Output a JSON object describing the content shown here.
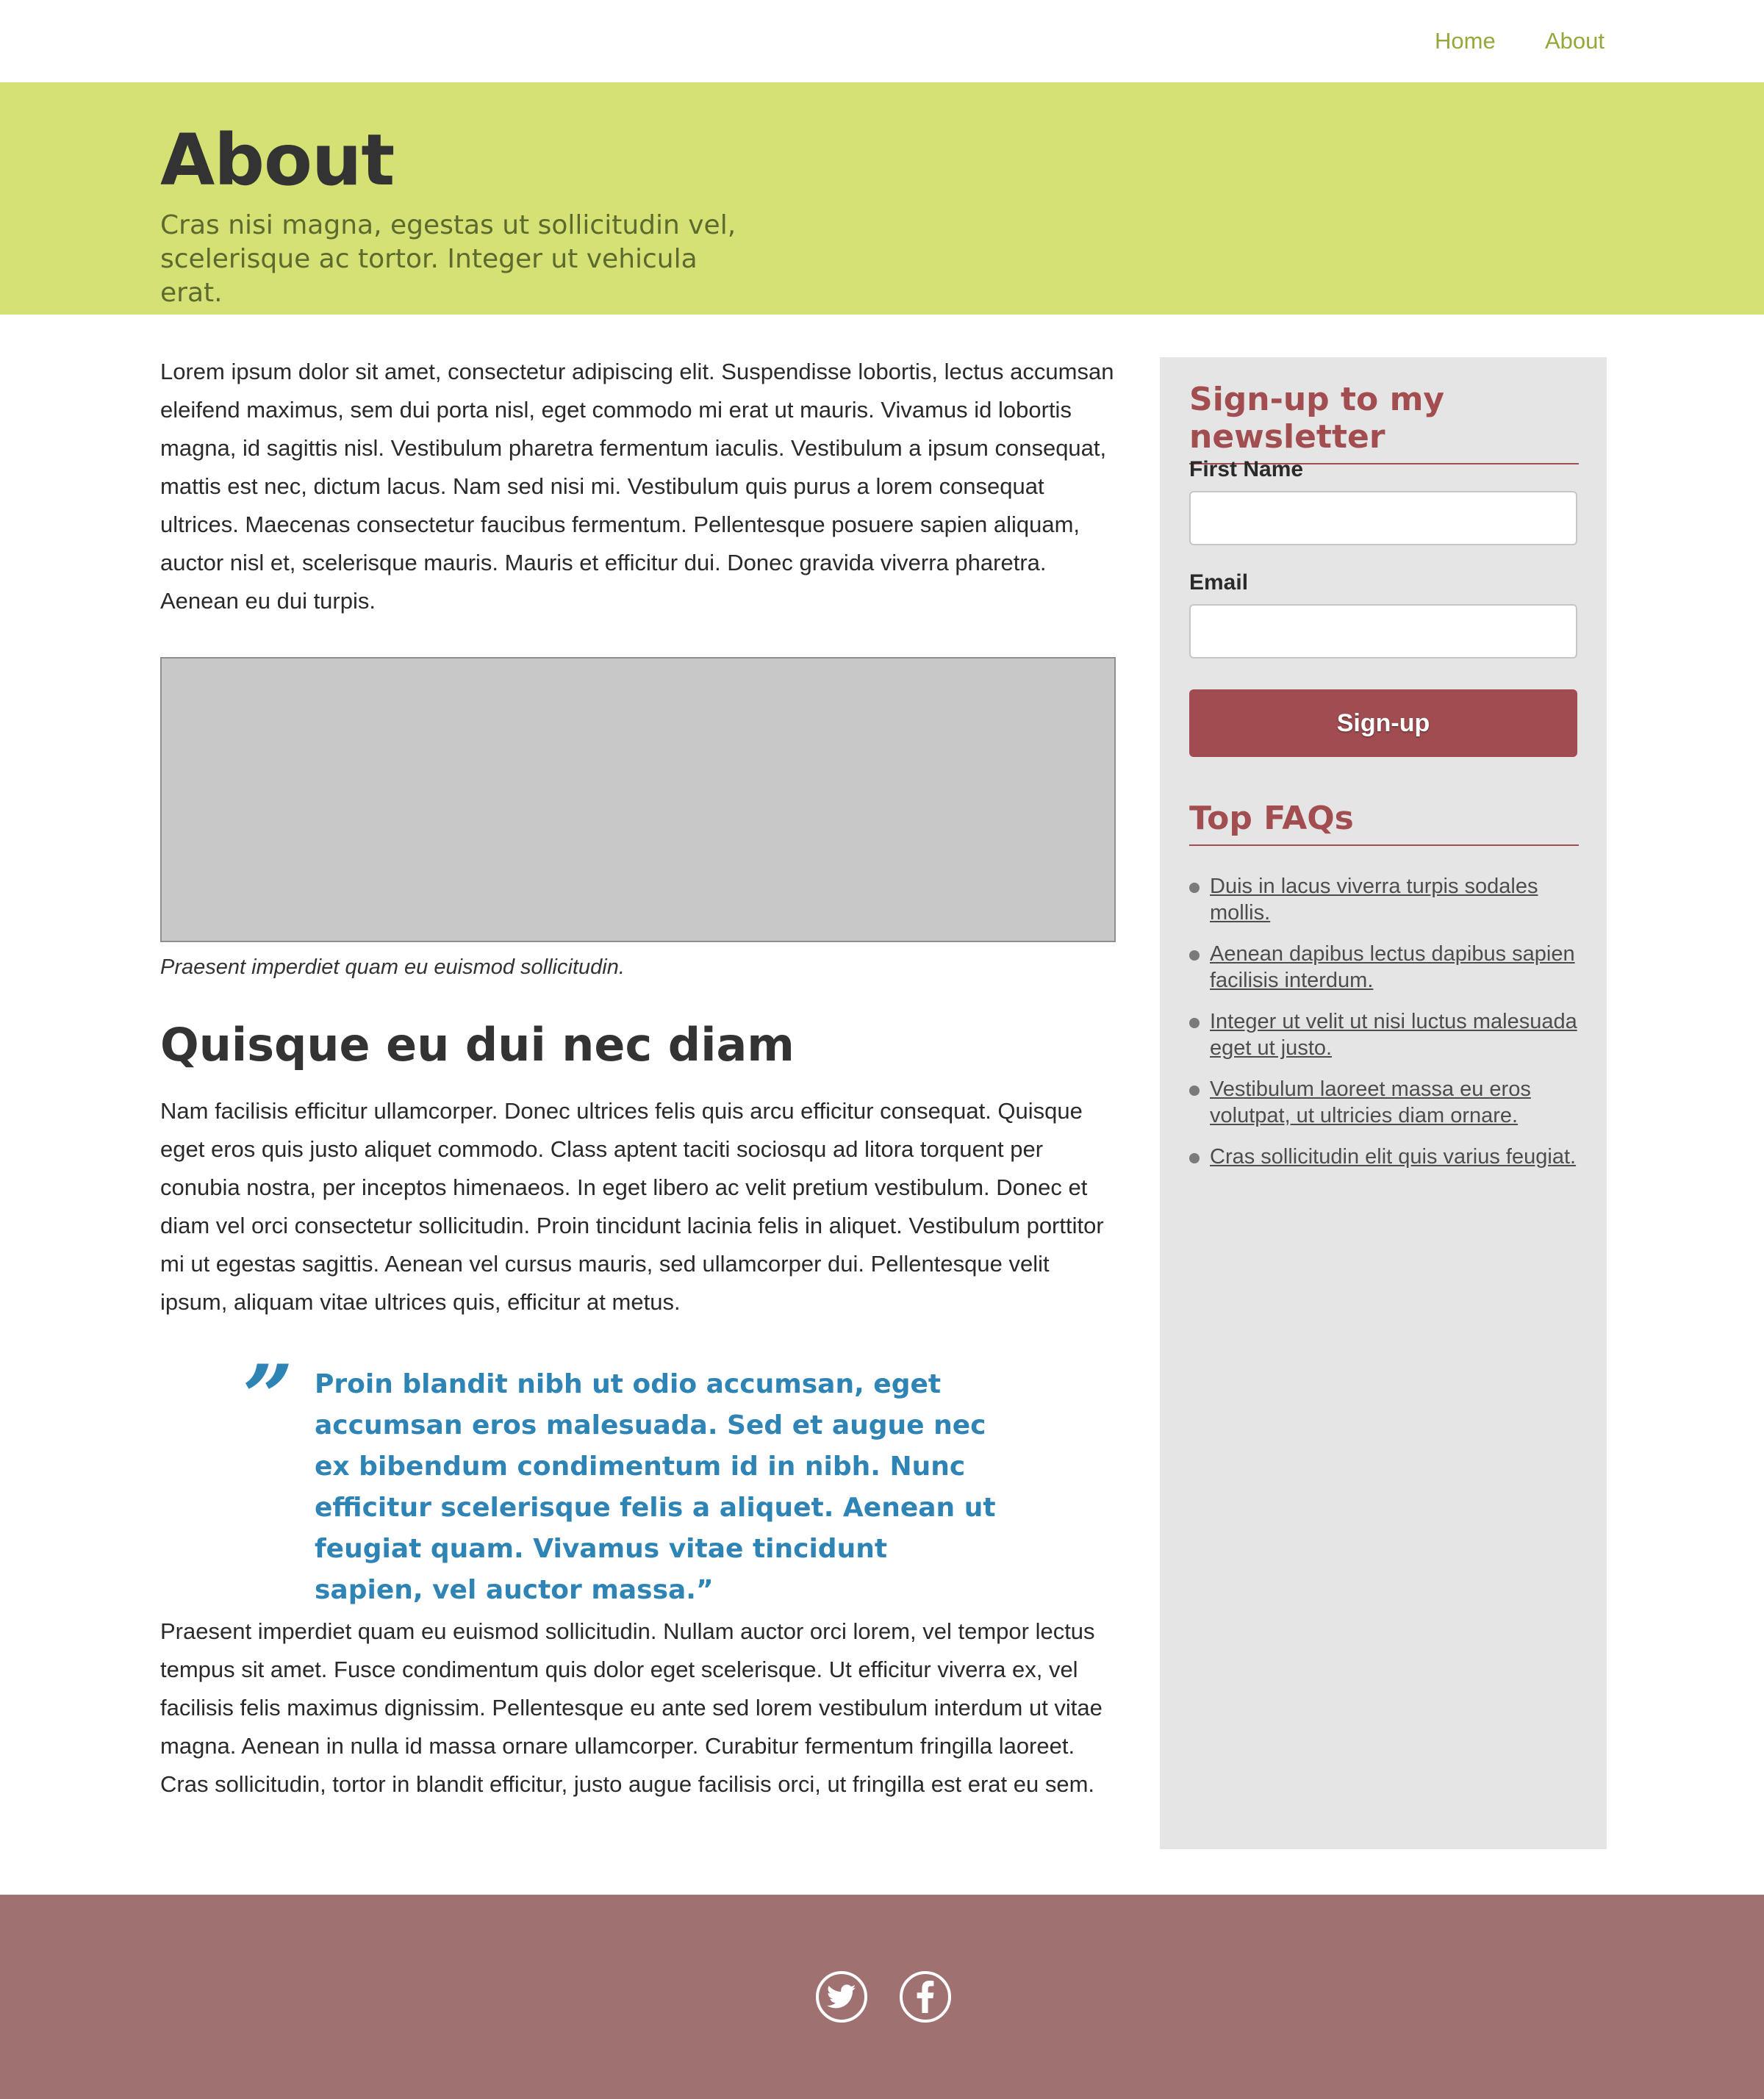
{
  "nav": {
    "home": "Home",
    "about": "About"
  },
  "hero": {
    "title": "About",
    "subtitle": "Cras nisi magna, egestas ut sollicitudin vel, scelerisque ac tortor. Integer ut vehicula erat."
  },
  "content": {
    "intro": "Lorem ipsum dolor sit amet, consectetur adipiscing elit. Suspendisse lobortis, lectus accumsan eleifend maximus, sem dui porta nisl, eget commodo mi erat ut mauris. Vivamus id lobortis magna, id sagittis nisl. Vestibulum pharetra fermentum iaculis. Vestibulum a ipsum consequat, mattis est nec, dictum lacus. Nam sed nisi mi. Vestibulum quis purus a lorem consequat ultrices. Maecenas consectetur faucibus fermentum. Pellentesque posuere sapien aliquam, auctor nisl et, scelerisque mauris. Mauris et efficitur dui. Donec gravida viverra pharetra. Aenean eu dui turpis.",
    "image_caption": "Praesent imperdiet quam eu euismod sollicitudin.",
    "heading": "Quisque eu dui nec diam",
    "body": "Nam facilisis efficitur ullamcorper. Donec ultrices felis quis arcu efficitur consequat. Quisque eget eros quis justo aliquet commodo. Class aptent taciti sociosqu ad litora torquent per conubia nostra, per inceptos himenaeos. In eget libero ac velit pretium vestibulum. Donec et diam vel orci consectetur sollicitudin. Proin tincidunt lacinia felis in aliquet. Vestibulum porttitor mi ut egestas sagittis. Aenean vel cursus mauris, sed ullamcorper dui. Pellentesque velit ipsum, aliquam vitae ultrices quis, efficitur at metus.",
    "quote_mark": "”",
    "quote": "Proin blandit nibh ut odio accumsan, eget accumsan eros malesuada. Sed et augue nec ex bibendum condimentum id in nibh. Nunc efficitur scelerisque felis a aliquet. Aenean ut feugiat quam. Vivamus vitae tincidunt sapien, vel auctor massa.”",
    "closing": "Praesent imperdiet quam eu euismod sollicitudin. Nullam auctor orci lorem, vel tempor lectus tempus sit amet. Fusce condimentum quis dolor eget scelerisque. Ut efficitur viverra ex, vel facilisis felis maximus dignissim. Pellentesque eu ante sed lorem vestibulum interdum ut vitae magna. Aenean in nulla id massa ornare ullamcorper. Curabitur fermentum fringilla laoreet. Cras sollicitudin, tortor in blandit efficitur, justo augue facilisis orci, ut fringilla est erat eu sem."
  },
  "sidebar": {
    "newsletter_title": "Sign-up to my newsletter",
    "first_name_label": "First Name",
    "first_name_value": "",
    "email_label": "Email",
    "email_value": "",
    "signup_label": "Sign-up",
    "faq_title": "Top FAQs",
    "faqs": [
      "Duis in lacus viverra turpis sodales mollis.",
      "Aenean dapibus lectus dapibus sapien facilisis interdum.",
      "Integer ut velit ut nisi luctus malesuada eget ut justo.",
      "Vestibulum laoreet massa eu eros volutpat, ut ultricies diam ornare.",
      "Cras sollicitudin elit quis varius feugiat."
    ]
  },
  "footer": {
    "icons": [
      "twitter-icon",
      "facebook-icon"
    ]
  },
  "colors": {
    "hero_bg": "#d5e174",
    "nav_link": "#95a83a",
    "accent_red": "#a24e51",
    "quote_blue": "#2f84b6",
    "footer_bg": "#a07171",
    "sidebar_bg": "#e5e5e5"
  }
}
